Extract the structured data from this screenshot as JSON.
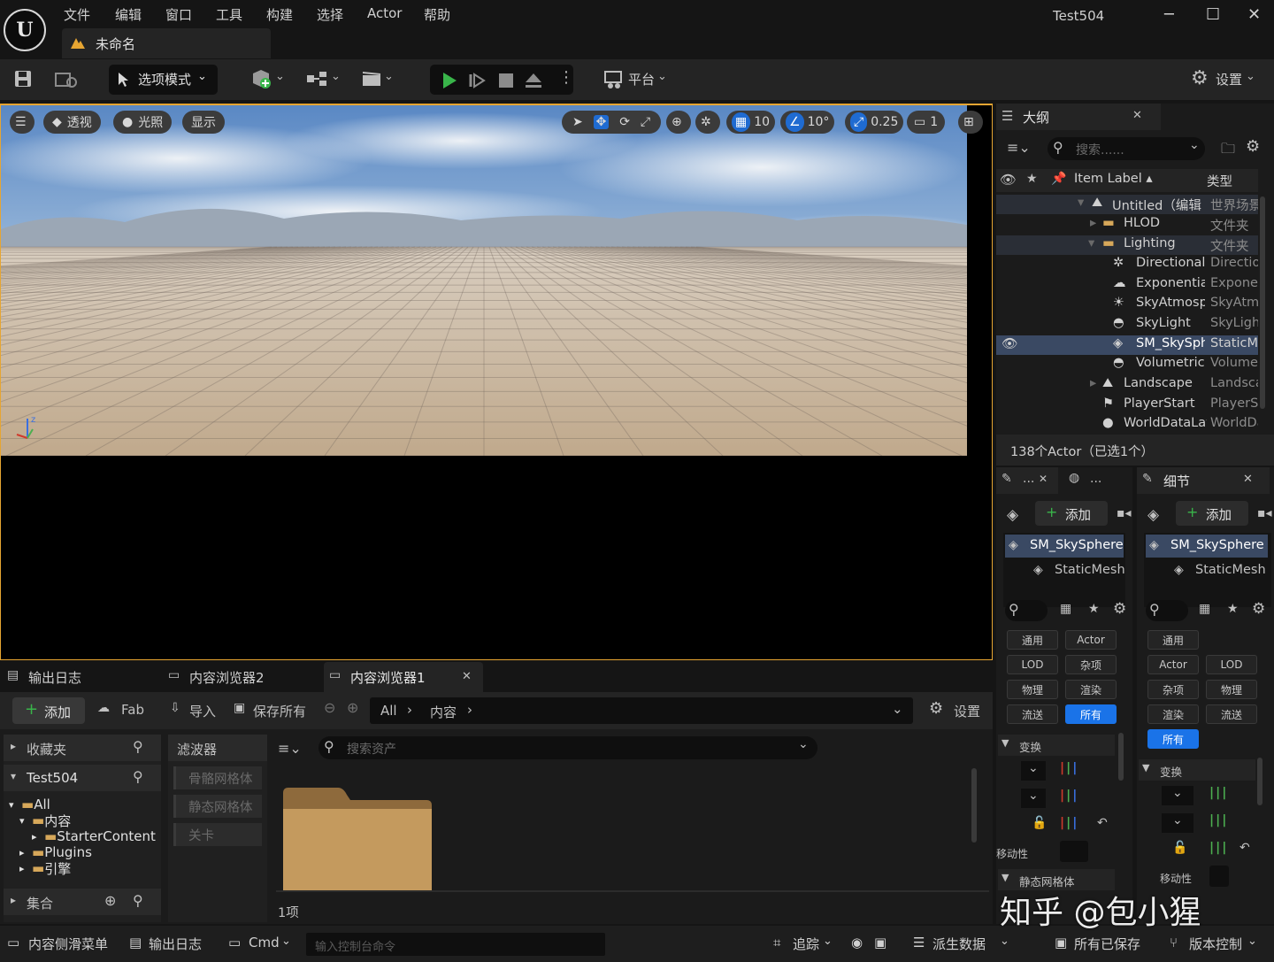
{
  "app": {
    "logo": "U",
    "window_title": "Test504",
    "tab_label": "未命名",
    "min": "─",
    "max": "☐",
    "close": "✕"
  },
  "menu": [
    "文件",
    "编辑",
    "窗口",
    "工具",
    "构建",
    "选择",
    "Actor",
    "帮助"
  ],
  "toolbar": {
    "mode_label": "选项模式",
    "platform_label": "平台",
    "settings_label": "设置"
  },
  "viewport": {
    "perspective": "透视",
    "lighting": "光照",
    "show": "显示",
    "grid_snap": "10",
    "rotate_snap": "10°",
    "scale_snap": "0.25",
    "camera_speed": "1"
  },
  "outliner": {
    "title": "大纲",
    "search_placeholder": "搜索......",
    "col_label": "Item Label ▴",
    "col_type": "类型",
    "rows": [
      {
        "name": "Untitled（编辑",
        "type": "世界场景"
      },
      {
        "name": "HLOD",
        "type": "文件夹"
      },
      {
        "name": "Lighting",
        "type": "文件夹"
      },
      {
        "name": "DirectionalLight",
        "type": "DirectionalLight"
      },
      {
        "name": "ExponentialHeightFog",
        "type": "ExponentialHeightFog"
      },
      {
        "name": "SkyAtmosphere",
        "type": "SkyAtmosphere"
      },
      {
        "name": "SkyLight",
        "type": "SkyLight"
      },
      {
        "name": "SM_SkySphere",
        "type": "StaticMeshActor"
      },
      {
        "name": "VolumetricCloud",
        "type": "VolumetricCloud"
      },
      {
        "name": "Landscape",
        "type": "Landscape"
      },
      {
        "name": "PlayerStart",
        "type": "PlayerStart"
      },
      {
        "name": "WorldDataLayers",
        "type": "WorldDataLayers"
      }
    ],
    "footer": "138个Actor（已选1个）"
  },
  "details_left": {
    "tab1": "...",
    "tab2": "...",
    "add_label": "添加",
    "selected": "SM_SkySphere",
    "component": "StaticMesh",
    "chips": [
      "通用",
      "Actor",
      "LOD",
      "杂项",
      "物理",
      "渲染",
      "流送",
      "所有"
    ],
    "section_transform": "变换",
    "row_mobility": "移动性",
    "section_static": "静态网格体"
  },
  "details_right": {
    "title": "细节",
    "add_label": "添加",
    "selected": "SM_SkySphere",
    "component": "StaticMesh",
    "chips": [
      "通用",
      "Actor",
      "LOD",
      "杂项",
      "物理",
      "渲染",
      "流送",
      "所有"
    ],
    "section_transform": "变换",
    "row_mobility": "移动性"
  },
  "bottom_tabs": {
    "tab1": "输出日志",
    "tab2": "内容浏览器2",
    "tab3": "内容浏览器1",
    "close": "✕"
  },
  "content_browser": {
    "add": "添加",
    "fab": "Fab",
    "import": "导入",
    "save_all": "保存所有",
    "path": [
      "All",
      "内容"
    ],
    "settings": "设置",
    "favorites": "收藏夹",
    "project": "Test504",
    "tree": [
      "All",
      "内容",
      "StarterContent",
      "Plugins",
      "引擎"
    ],
    "collections": "集合",
    "filters_title": "滤波器",
    "filters": [
      "骨骼网格体",
      "静态网格体",
      "关卡"
    ],
    "search_placeholder": "搜索资产",
    "item_count": "1项"
  },
  "status": {
    "drawer": "内容侧滑菜单",
    "log": "输出日志",
    "cmd": "Cmd",
    "console_placeholder": "输入控制台命令",
    "trace": "追踪",
    "derived": "派生数据",
    "saved": "所有已保存",
    "vcs": "版本控制"
  },
  "watermark": "知乎 @包小猩"
}
